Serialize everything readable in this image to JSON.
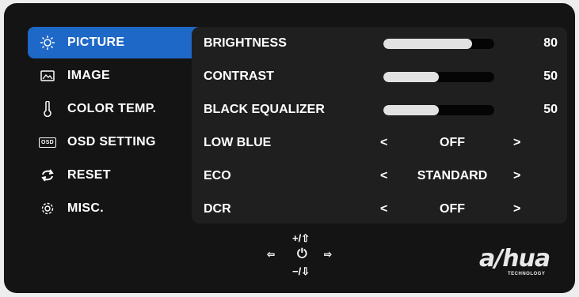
{
  "sidebar": {
    "items": [
      {
        "label": "PICTURE",
        "icon": "sun-icon",
        "active": true
      },
      {
        "label": "IMAGE",
        "icon": "image-icon"
      },
      {
        "label": "COLOR TEMP.",
        "icon": "thermometer-icon"
      },
      {
        "label": "OSD SETTING",
        "icon": "osd-icon",
        "icon_text": "OSD"
      },
      {
        "label": "RESET",
        "icon": "reset-icon"
      },
      {
        "label": "MISC.",
        "icon": "gear-icon"
      }
    ]
  },
  "picture": {
    "sliders": [
      {
        "label": "BRIGHTNESS",
        "value": "80",
        "level": 80
      },
      {
        "label": "CONTRAST",
        "value": "50",
        "level": 50
      },
      {
        "label": "BLACK EQUALIZER",
        "value": "50",
        "level": 50
      }
    ],
    "options": [
      {
        "label": "LOW BLUE",
        "value": "OFF"
      },
      {
        "label": "ECO",
        "value": "STANDARD"
      },
      {
        "label": "DCR",
        "value": "OFF"
      }
    ],
    "chevron_left": "<",
    "chevron_right": ">"
  },
  "navigation": {
    "up": "+/⇧",
    "down": "−/⇩",
    "enter": "⏻",
    "left": "⇦",
    "right": "⇨"
  },
  "brand": {
    "name": "a/hua",
    "tagline": "TECHNOLOGY"
  },
  "colors": {
    "accent": "#1e68c8",
    "background": "#141414",
    "panel": "#1f1f1f",
    "bar_fill": "#e2e2e2"
  }
}
